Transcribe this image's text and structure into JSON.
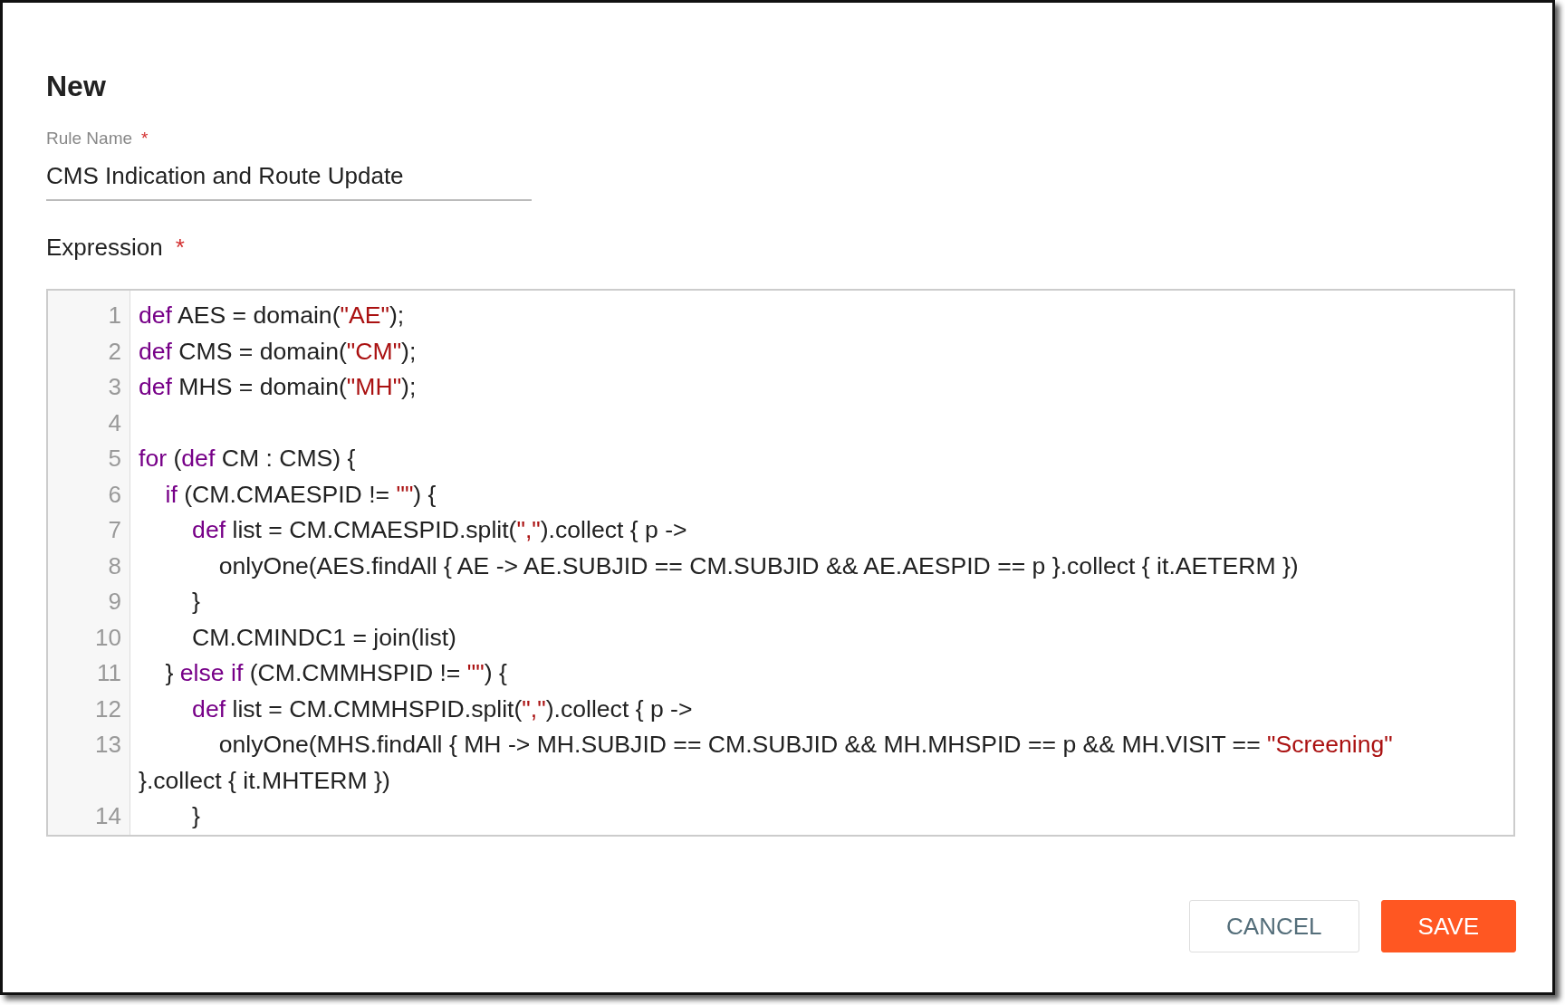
{
  "dialog": {
    "title": "New"
  },
  "rule_name": {
    "label": "Rule Name",
    "required_mark": "*",
    "value": "CMS Indication and Route Update"
  },
  "expression": {
    "label": "Expression",
    "required_mark": "*",
    "lines": [
      {
        "number": "1",
        "tokens": [
          {
            "kind": "keyword",
            "text": "def"
          },
          {
            "kind": "plain",
            "text": " AES = domain("
          },
          {
            "kind": "string",
            "text": "\"AE\""
          },
          {
            "kind": "plain",
            "text": ");"
          }
        ]
      },
      {
        "number": "2",
        "tokens": [
          {
            "kind": "keyword",
            "text": "def"
          },
          {
            "kind": "plain",
            "text": " CMS = domain("
          },
          {
            "kind": "string",
            "text": "\"CM\""
          },
          {
            "kind": "plain",
            "text": ");"
          }
        ]
      },
      {
        "number": "3",
        "tokens": [
          {
            "kind": "keyword",
            "text": "def"
          },
          {
            "kind": "plain",
            "text": " MHS = domain("
          },
          {
            "kind": "string",
            "text": "\"MH\""
          },
          {
            "kind": "plain",
            "text": ");"
          }
        ]
      },
      {
        "number": "4"
      },
      {
        "number": "5",
        "tokens": [
          {
            "kind": "keyword",
            "text": "for"
          },
          {
            "kind": "plain",
            "text": " ("
          },
          {
            "kind": "keyword",
            "text": "def"
          },
          {
            "kind": "plain",
            "text": " CM : CMS) {"
          }
        ]
      },
      {
        "number": "6",
        "tokens": [
          {
            "kind": "keyword",
            "text": "    if"
          },
          {
            "kind": "plain",
            "text": " (CM.CMAESPID != "
          },
          {
            "kind": "string",
            "text": "\"\""
          },
          {
            "kind": "plain",
            "text": ") {"
          }
        ]
      },
      {
        "number": "7",
        "tokens": [
          {
            "kind": "keyword",
            "text": "        def"
          },
          {
            "kind": "plain",
            "text": " list = CM.CMAESPID.split("
          },
          {
            "kind": "string",
            "text": "\",\""
          },
          {
            "kind": "plain",
            "text": ").collect { p ->"
          }
        ]
      },
      {
        "number": "8",
        "tokens": [
          {
            "kind": "plain",
            "text": "            onlyOne(AES.findAll { AE -> AE.SUBJID == CM.SUBJID && AE.AESPID == p }.collect { it.AETERM })"
          }
        ]
      },
      {
        "number": "9",
        "tokens": [
          {
            "kind": "plain",
            "text": "        }"
          }
        ]
      },
      {
        "number": "10",
        "tokens": [
          {
            "kind": "plain",
            "text": "        CM.CMINDC1 = join(list)"
          }
        ]
      },
      {
        "number": "11",
        "tokens": [
          {
            "kind": "plain",
            "text": "    } "
          },
          {
            "kind": "keyword",
            "text": "else if"
          },
          {
            "kind": "plain",
            "text": " (CM.CMMHSPID != "
          },
          {
            "kind": "string",
            "text": "\"\""
          },
          {
            "kind": "plain",
            "text": ") {"
          }
        ]
      },
      {
        "number": "12",
        "tokens": [
          {
            "kind": "keyword",
            "text": "        def"
          },
          {
            "kind": "plain",
            "text": " list = CM.CMMHSPID.split("
          },
          {
            "kind": "string",
            "text": "\",\""
          },
          {
            "kind": "plain",
            "text": ").collect { p ->"
          }
        ]
      },
      {
        "number": "13",
        "tokens": [
          {
            "kind": "plain",
            "text": "            onlyOne(MHS.findAll { MH -> MH.SUBJID == CM.SUBJID && MH.MHSPID == p && MH.VISIT == "
          },
          {
            "kind": "string",
            "text": "\"Screening\""
          }
        ],
        "continuation": [
          {
            "kind": "plain",
            "text": "}.collect { it.MHTERM })"
          }
        ]
      },
      {
        "number": "14",
        "tokens": [
          {
            "kind": "plain",
            "text": "        }"
          }
        ]
      }
    ]
  },
  "buttons": [
    {
      "label": "CANCEL",
      "kind": "secondary"
    },
    {
      "label": "SAVE",
      "kind": "primary"
    }
  ]
}
